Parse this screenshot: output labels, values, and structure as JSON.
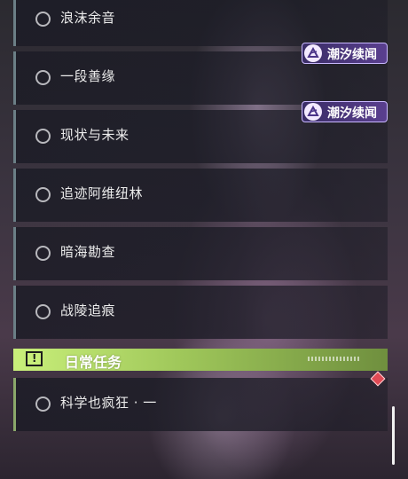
{
  "quests": [
    {
      "label": "浪沫余音"
    },
    {
      "label": "一段善缘"
    },
    {
      "label": "现状与未来"
    },
    {
      "label": "追迹阿维纽林"
    },
    {
      "label": "暗海勘查"
    },
    {
      "label": "战陵追痕"
    }
  ],
  "tags": [
    {
      "label": "潮汐续闻"
    },
    {
      "label": "潮汐续闻"
    }
  ],
  "daily_section": {
    "title": "日常任务",
    "icon": "exclamation-icon"
  },
  "daily_quests": [
    {
      "label": "科学也疯狂 · 一"
    }
  ],
  "colors": {
    "accent_green": "#c9ef7a",
    "tag_purple": "#5a3f8f",
    "marker_red": "#e04a55"
  }
}
